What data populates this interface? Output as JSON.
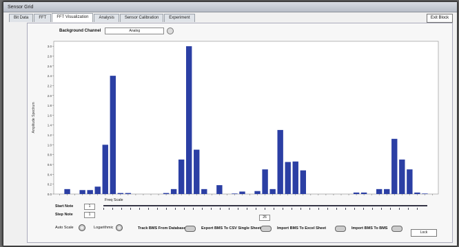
{
  "window": {
    "title": "Sensor Grid"
  },
  "tabs": [
    "Bit Data",
    "FFT",
    "FFT Visualization",
    "Analysis",
    "Sensor Calibration",
    "Experiment"
  ],
  "active_tab": 2,
  "exit_button": "Exit Block",
  "waveform": {
    "label": "Background Channel",
    "value": "Analog"
  },
  "chart_data": {
    "type": "bar",
    "ylabel": "Amplitude Spectrum",
    "yticks": [
      "0.0",
      "0.2",
      "0.4",
      "0.6",
      "0.8",
      "1.0",
      "1.2",
      "1.4",
      "1.6",
      "1.8",
      "2.0",
      "2.2",
      "2.4",
      "2.6",
      "2.8",
      "3.0"
    ],
    "ylim": [
      0,
      3.1
    ],
    "bar_color": "#2b3fa4",
    "values": [
      0,
      0.1,
      0,
      0.08,
      0.08,
      0.15,
      1.0,
      2.4,
      0.02,
      0.02,
      0,
      0,
      0,
      0,
      0.02,
      0.1,
      0.7,
      3.0,
      0.9,
      0.1,
      0,
      0.18,
      0,
      0.01,
      0.05,
      0,
      0.06,
      0.5,
      0.1,
      1.3,
      0.65,
      0.66,
      0.48,
      0,
      0,
      0,
      0,
      0,
      0,
      0.03,
      0.03,
      0,
      0.1,
      0.1,
      1.12,
      0.7,
      0.5,
      0.03,
      0.01,
      0
    ]
  },
  "controls": {
    "start_label": "Start Note",
    "start_value": "1",
    "step_label": "Step Note",
    "step_value": "1",
    "freq_label": "Freq Scale",
    "auto_label": "Auto Scale",
    "log_label": "Logarithmic",
    "toggle1": "Track BMS From Database",
    "toggle2": "Export BMS To CSV Single Sheet",
    "toggle3": "Import BMS To Excel Sheet",
    "toggle4": "Import BMS To BMS",
    "lock_button": "Lock",
    "slider_value": "26"
  }
}
